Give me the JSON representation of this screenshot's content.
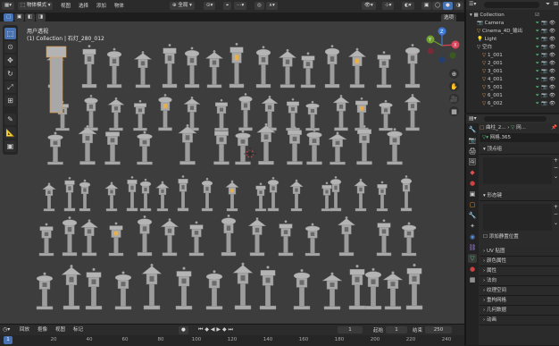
{
  "header": {
    "mode_label": "物体模式",
    "menus": [
      "视图",
      "选择",
      "添加",
      "物体"
    ],
    "orientation_label": "全局",
    "options_label": "选项"
  },
  "viewport": {
    "view_name": "用户透视",
    "active_object": "(1) Collection | 石灯_280_012",
    "gizmo_axes": {
      "x": "X",
      "y": "Y",
      "z": "Z"
    }
  },
  "outliner": {
    "search_placeholder": "",
    "root": "Collection",
    "items": [
      {
        "label": "Camera",
        "color": "#6aa5e8"
      },
      {
        "label": "Cinema_4D_输出",
        "color": "#e0a050"
      },
      {
        "label": "Light",
        "color": "#e0a050"
      },
      {
        "label": "空白",
        "color": "#c0c0c0"
      },
      {
        "label": "1_001",
        "color": "#e0a050"
      },
      {
        "label": "2_001",
        "color": "#e0a050"
      },
      {
        "label": "3_001",
        "color": "#e0a050"
      },
      {
        "label": "4_001",
        "color": "#e0a050"
      },
      {
        "label": "5_001",
        "color": "#e0a050"
      },
      {
        "label": "6_001",
        "color": "#e0a050"
      },
      {
        "label": "6_002",
        "color": "#e0a050"
      }
    ]
  },
  "properties": {
    "breadcrumb_a": "曲柱_2...",
    "breadcrumb_b": "网...",
    "mesh_name": "网格.365",
    "sections": {
      "vertex_groups": "顶点组",
      "shape_keys": "形态键",
      "add_rest_position": "添加静置位置",
      "uv_maps": "UV 贴图",
      "color_attributes": "颜色属性",
      "attributes": "属性",
      "normals": "法向",
      "texture_space": "纹理空间",
      "remesh": "重构网格",
      "geometry_data": "几何数据",
      "animation": "动画"
    }
  },
  "timeline": {
    "menus": [
      "回放",
      "抠像",
      "视图",
      "标记"
    ],
    "current_frame": "1",
    "start_label": "起始",
    "start_value": "1",
    "end_label": "结束",
    "end_value": "250",
    "ticks": [
      "1",
      "20",
      "40",
      "60",
      "80",
      "100",
      "120",
      "140",
      "160",
      "180",
      "200",
      "220",
      "240"
    ]
  },
  "colors": {
    "accent": "#4772b3",
    "viewport_bg": "#3d3d3d",
    "object": "#a8a8a8",
    "selection": "#e89b3c"
  }
}
